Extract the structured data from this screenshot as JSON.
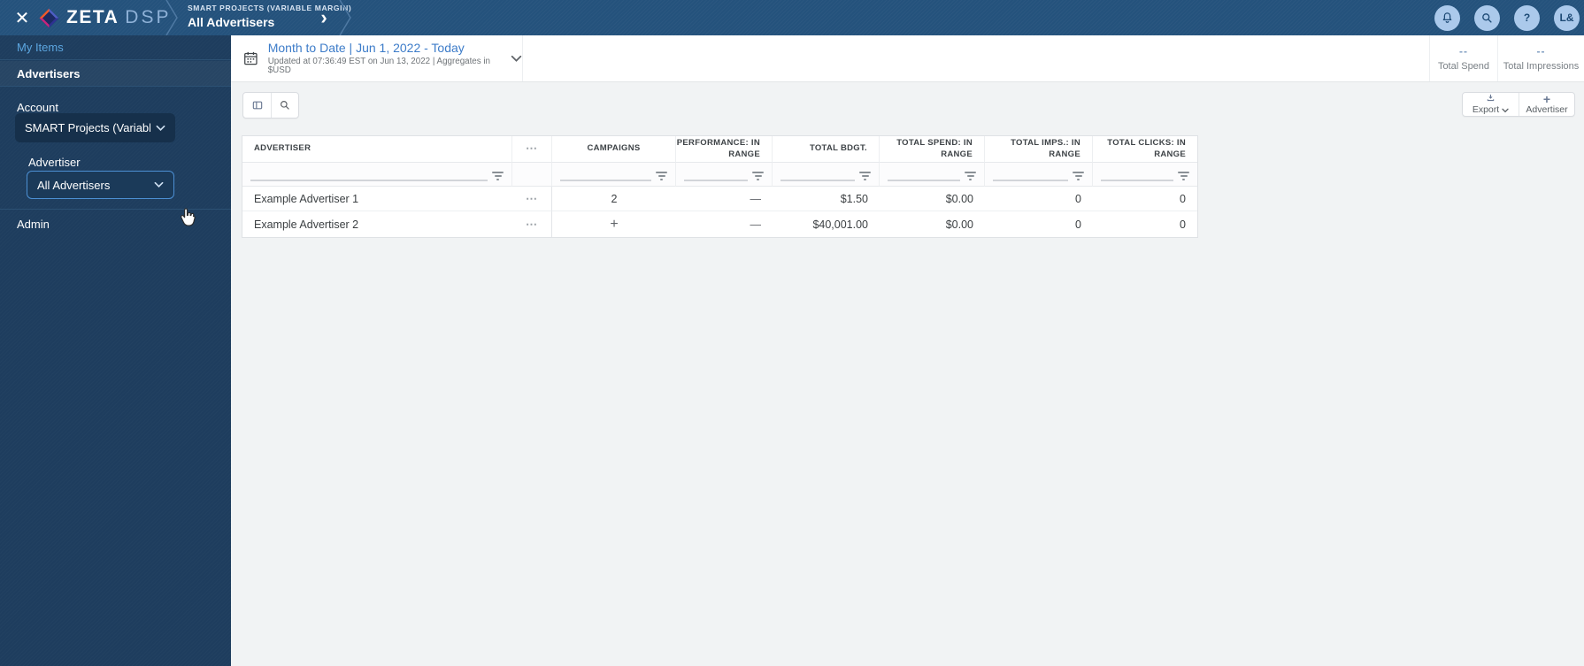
{
  "icons": {
    "close": "✕",
    "chevron_right": "›",
    "more_options": "⋯",
    "add": "+",
    "help": "?"
  },
  "colors": {
    "topbar_bg": "#24527C",
    "sidebar_bg": "#1E3D5E",
    "link_blue": "#5CA6E0",
    "date_link_blue": "#3D7CC9",
    "select_border_blue": "#4C8FD3",
    "action_circle_bg": "#ABC9EB",
    "stat_value_blue": "#7E9CC0"
  },
  "topbar": {
    "brand_name": "ZETA",
    "brand_suffix": "DSP",
    "breadcrumb_eyebrow": "SMART PROJECTS (VARIABLE MARGIN)",
    "breadcrumb_title": "All Advertisers",
    "avatar_initials": "L&"
  },
  "sidebar": {
    "my_items_label": "My Items",
    "advertisers_label": "Advertisers",
    "account_label": "Account",
    "account_value": "SMART Projects (Variable M",
    "advertiser_label": "Advertiser",
    "advertiser_value": "All Advertisers",
    "admin_label": "Admin"
  },
  "header": {
    "date_title": "Month to Date | Jun 1, 2022 - Today",
    "date_subtitle": "Updated at 07:36:49 EST on Jun 13, 2022 | Aggregates in $USD",
    "stats": [
      {
        "value": "--",
        "label": "Total Spend"
      },
      {
        "value": "--",
        "label": "Total Impressions"
      }
    ]
  },
  "toolbar": {
    "export_label": "Export",
    "advertiser_button_label": "Advertiser"
  },
  "table": {
    "columns": [
      "ADVERTISER",
      "CAMPAIGNS",
      "PERFORMANCE: IN RANGE",
      "TOTAL BDGT.",
      "TOTAL SPEND: IN RANGE",
      "TOTAL IMPS.: IN RANGE",
      "TOTAL CLICKS: IN RANGE"
    ],
    "rows": [
      {
        "advertiser": "Example Advertiser 1",
        "campaigns": "2",
        "performance": "—",
        "total_budget": "$1.50",
        "total_spend": "$0.00",
        "total_impressions": "0",
        "total_clicks": "0"
      },
      {
        "advertiser": "Example Advertiser 2",
        "campaigns": "+",
        "performance": "—",
        "total_budget": "$40,001.00",
        "total_spend": "$0.00",
        "total_impressions": "0",
        "total_clicks": "0"
      }
    ]
  }
}
